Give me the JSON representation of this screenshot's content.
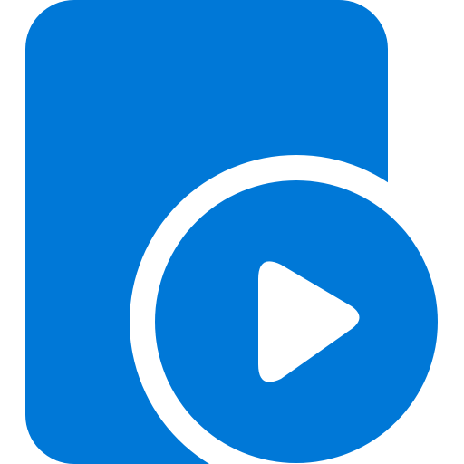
{
  "icon": {
    "name": "video-file-icon",
    "colors": {
      "primary": "#0078D7",
      "background": "#FFFFFF"
    }
  }
}
